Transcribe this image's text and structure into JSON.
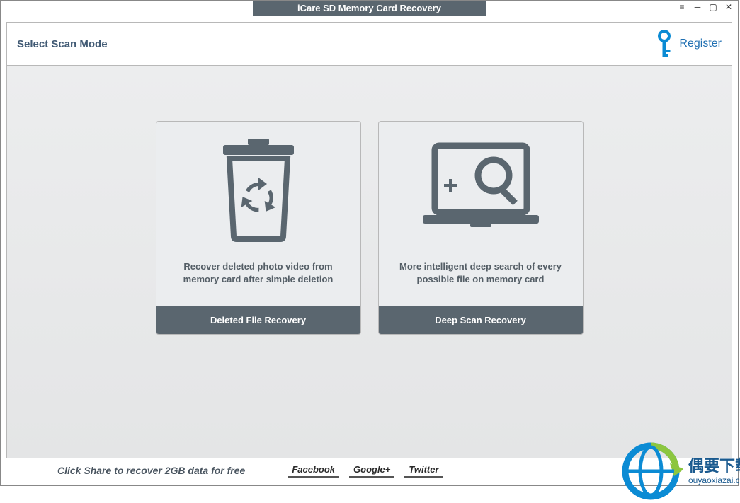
{
  "window": {
    "title": "iCare SD Memory Card Recovery"
  },
  "header": {
    "title": "Select Scan Mode",
    "register_label": "Register"
  },
  "cards": {
    "deleted": {
      "desc": "Recover deleted photo video from memory card after simple deletion",
      "button": "Deleted File Recovery"
    },
    "deep": {
      "desc": "More intelligent deep search of every possible file on memory card",
      "button": "Deep Scan Recovery"
    }
  },
  "footer": {
    "share_text": "Click Share to recover 2GB data for free",
    "links": {
      "facebook": "Facebook",
      "googleplus": "Google+",
      "twitter": "Twitter"
    }
  },
  "watermark": {
    "cn": "偶要下载站",
    "url": "ouyaoxiazai.com"
  }
}
